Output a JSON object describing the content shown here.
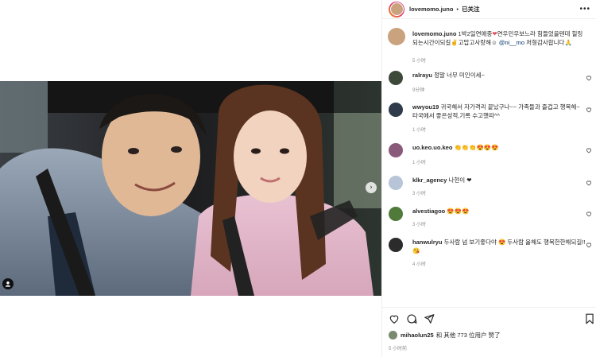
{
  "header": {
    "username": "lovemomo.juno",
    "separator": "•",
    "follow_label": "已关注",
    "more_icon": "more-horizontal-icon"
  },
  "caption": {
    "username": "lovemomo.juno",
    "text_before": "1박2일연애중",
    "text_mid": "연우민우보느라 힘들었을텐데 힐링되는시간이되길",
    "text_mid2": "고맙고사랑해",
    "mention": "@ni__mo",
    "text_after": "처형감사합니다",
    "time": "5 小时"
  },
  "comments": [
    {
      "username": "ralrayu",
      "text": "정말 너무 미인이세~",
      "time": "9分钟",
      "avatar_color": "#3d4a3a"
    },
    {
      "username": "wwyou19",
      "text": "귀국해서 자가격리 끝났구나~~ 가족들과 즐겁고 행복해~ 타국에서 좋은성적,기록 수고했따^^",
      "time": "1 小时",
      "avatar_color": "#2f3b4a"
    },
    {
      "username": "uo.keo.uo.keo",
      "text": "👏👏👏😍😍😍",
      "time": "1 小时",
      "avatar_color": "#8a5a7a"
    },
    {
      "username": "klkr_agency",
      "text": "나현이 ❤",
      "time": "3 小时",
      "avatar_color": "#b8c4d8"
    },
    {
      "username": "alvestiagoo",
      "text": "😍😍😍",
      "time": "3 小时",
      "avatar_color": "#4f7a3a"
    },
    {
      "username": "hanwulryu",
      "text": "두사람 넘 보기좋다야 😍 두사람 올해도 행복한한해되길!!😘",
      "time": "4 小时",
      "avatar_color": "#2b2b2b"
    }
  ],
  "actions": {
    "like_icon": "heart-icon",
    "comment_icon": "comment-icon",
    "share_icon": "share-icon",
    "save_icon": "bookmark-icon"
  },
  "likes": {
    "username": "mihaolun25",
    "text": "和 其他 773 位用户 赞了"
  },
  "post_time": "5 小时前",
  "colors": {
    "text_primary": "#262626",
    "text_secondary": "#8e8e8e",
    "heart_red": "#ed4956",
    "border": "#efefef"
  }
}
